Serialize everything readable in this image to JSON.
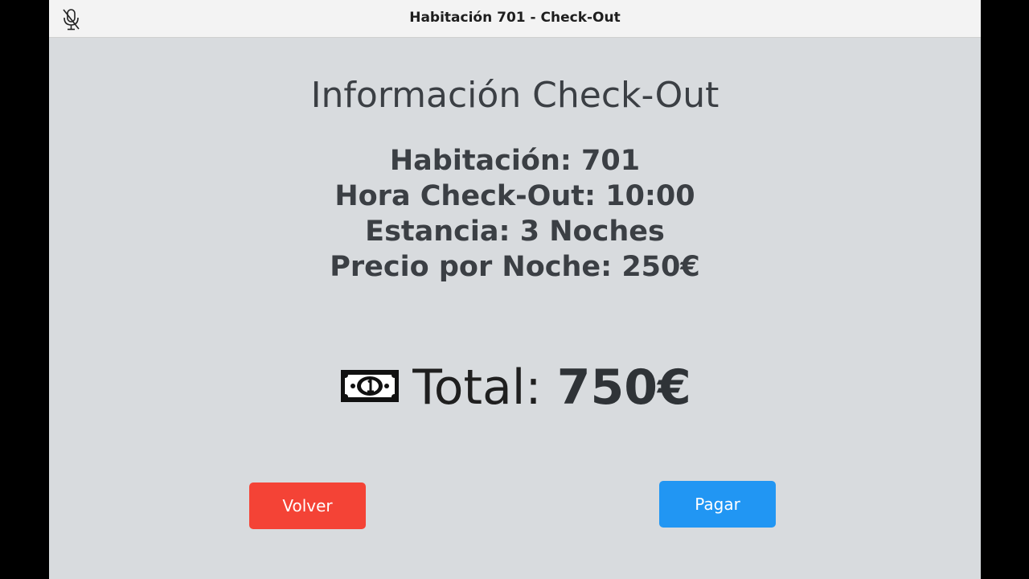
{
  "window": {
    "title": "Habitación 701 - Check-Out",
    "mic_icon": "microphone-muted-icon"
  },
  "main": {
    "heading": "Información Check-Out",
    "details": [
      "Habitación: 701",
      "Hora Check-Out: 10:00",
      "Estancia: 3 Noches",
      "Precio por Noche: 250€"
    ],
    "total_icon": "money-bill-icon",
    "total_label": "Total: ",
    "total_value": "750€"
  },
  "actions": {
    "back_label": "Volver",
    "pay_label": "Pagar"
  },
  "colors": {
    "background": "#d8dbde",
    "back_button": "#f44336",
    "pay_button": "#2196f3"
  }
}
